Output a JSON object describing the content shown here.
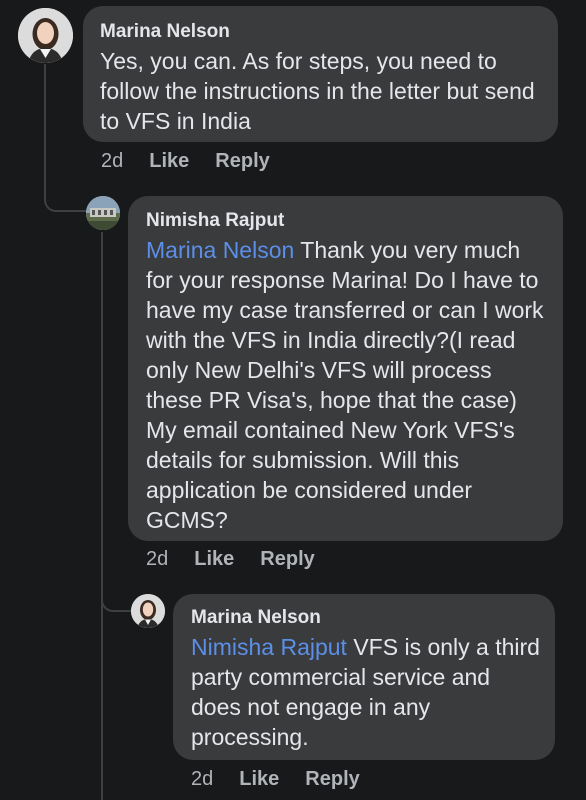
{
  "comments": [
    {
      "author": "Marina Nelson",
      "mention": "",
      "text": "Yes, you can. As for steps, you need to follow the instructions in the letter but send to VFS in India",
      "time": "2d",
      "like_label": "Like",
      "reply_label": "Reply",
      "avatar_icon": "profile-photo-woman"
    },
    {
      "author": "Nimisha Rajput",
      "mention": "Marina Nelson",
      "text": "Thank you very much for your response Marina! Do I have to have my case transferred or can I work with the VFS in India directly?(I read only New Delhi's VFS will process these PR Visa's, hope that the case) My email contained New York VFS's details for submission. Will this application be considered under GCMS?",
      "time": "2d",
      "like_label": "Like",
      "reply_label": "Reply",
      "avatar_icon": "profile-photo-outdoor"
    },
    {
      "author": "Marina Nelson",
      "mention": "Nimisha Rajput",
      "text": "VFS is only a third party commercial service and does not engage in any processing.",
      "time": "2d",
      "like_label": "Like",
      "reply_label": "Reply",
      "avatar_icon": "profile-photo-woman"
    }
  ],
  "colors": {
    "background": "#18191a",
    "bubble": "#3a3b3c",
    "mention": "#5b8fe8",
    "meta": "#b0b3b8"
  }
}
